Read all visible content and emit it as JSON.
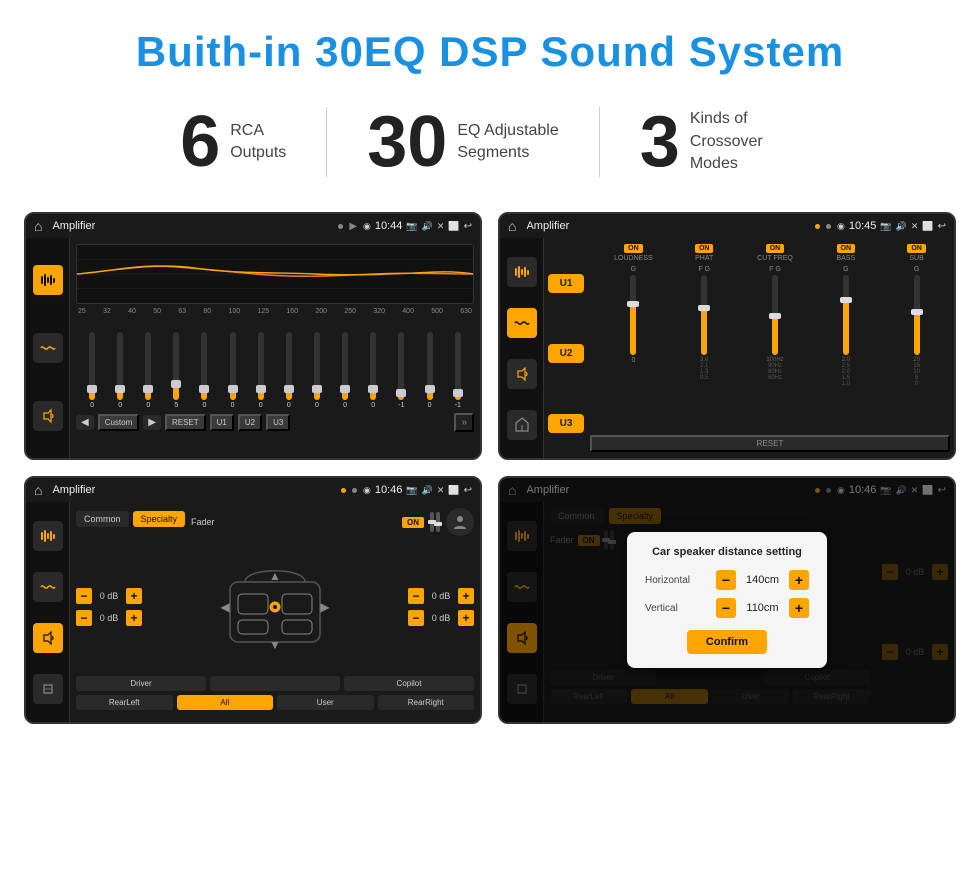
{
  "page": {
    "title": "Buith-in 30EQ DSP Sound System"
  },
  "stats": [
    {
      "number": "6",
      "label_line1": "RCA",
      "label_line2": "Outputs"
    },
    {
      "number": "30",
      "label_line1": "EQ Adjustable",
      "label_line2": "Segments"
    },
    {
      "number": "3",
      "label_line1": "Kinds of",
      "label_line2": "Crossover Modes"
    }
  ],
  "screens": {
    "screen1": {
      "title": "Amplifier",
      "time": "10:44",
      "eq_labels": [
        "25",
        "32",
        "40",
        "50",
        "63",
        "80",
        "100",
        "125",
        "160",
        "200",
        "250",
        "320",
        "400",
        "500",
        "630"
      ],
      "eq_values": [
        "0",
        "0",
        "0",
        "5",
        "0",
        "0",
        "0",
        "0",
        "0",
        "0",
        "0",
        "-1",
        "0",
        "-1"
      ],
      "bottom_btns": [
        "Custom",
        "RESET",
        "U1",
        "U2",
        "U3"
      ]
    },
    "screen2": {
      "title": "Amplifier",
      "time": "10:45",
      "channels": [
        "U1",
        "U2",
        "U3"
      ],
      "controls": [
        "LOUDNESS",
        "PHAT",
        "CUT FREQ",
        "BASS",
        "SUB"
      ]
    },
    "screen3": {
      "title": "Amplifier",
      "time": "10:46",
      "tabs": [
        "Common",
        "Specialty"
      ],
      "active_tab": "Specialty",
      "fader_label": "Fader",
      "fader_on": "ON",
      "db_values": [
        "0 dB",
        "0 dB",
        "0 dB",
        "0 dB"
      ],
      "bottom_btns": [
        "Driver",
        "",
        "Copilot",
        "RearLeft",
        "All",
        "User",
        "RearRight"
      ]
    },
    "screen4": {
      "title": "Amplifier",
      "time": "10:46",
      "tabs": [
        "Common",
        "Specialty"
      ],
      "dialog": {
        "title": "Car speaker distance setting",
        "horizontal_label": "Horizontal",
        "horizontal_value": "140cm",
        "vertical_label": "Vertical",
        "vertical_value": "110cm",
        "confirm_label": "Confirm"
      }
    }
  },
  "icons": {
    "home": "⌂",
    "back": "↩",
    "location": "◉",
    "camera": "📷",
    "volume": "🔊",
    "close": "✕",
    "window": "⬜",
    "eq": "≡",
    "wave": "〜",
    "speaker": "◈",
    "arrow_right": "▶",
    "arrow_left": "◀",
    "chevron": "»"
  }
}
